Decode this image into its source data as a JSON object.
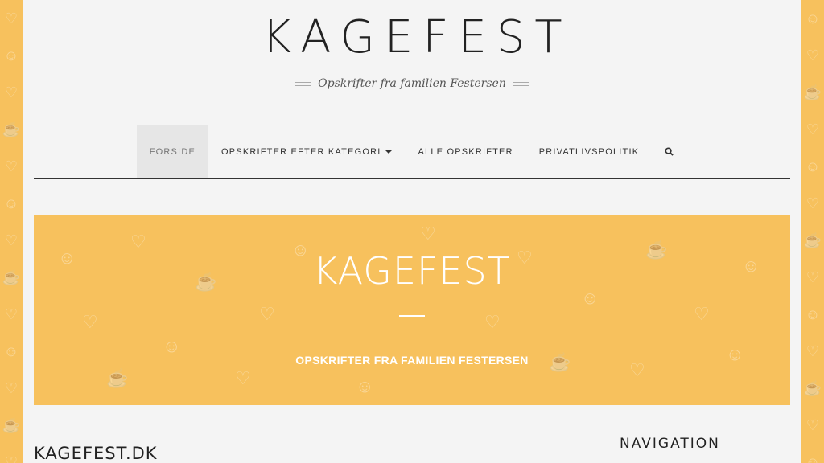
{
  "header": {
    "site_title": "KAGEFEST",
    "tagline": "Opskrifter fra familien Festersen"
  },
  "nav": {
    "items": [
      {
        "label": "FORSIDE",
        "active": true
      },
      {
        "label": "OPSKRIFTER EFTER KATEGORI",
        "dropdown": true
      },
      {
        "label": "ALLE OPSKRIFTER"
      },
      {
        "label": "PRIVATLIVSPOLITIK"
      }
    ],
    "search_icon": "search-icon"
  },
  "hero": {
    "title": "KAGEFEST",
    "subtitle": "OPSKRIFTER FRA FAMILIEN FESTERSEN"
  },
  "content": {
    "post_title": "KAGEFEST.DK"
  },
  "sidebar": {
    "widget_title": "NAVIGATION"
  },
  "colors": {
    "accent": "#f7c15d",
    "page_bg": "#f4f4f4",
    "text": "#222222"
  }
}
